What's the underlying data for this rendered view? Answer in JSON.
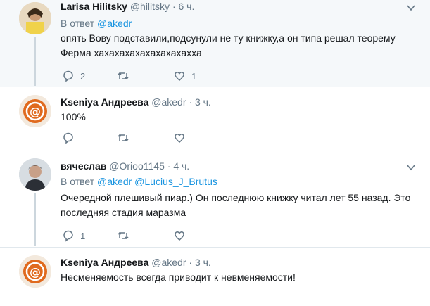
{
  "tweets": [
    {
      "name": "Larisa Hilitsky",
      "handle": "@hilitsky",
      "dot": "·",
      "time": "6 ч.",
      "reply_prefix": "В ответ",
      "reply_to": [
        "@akedr"
      ],
      "text": "опять Вову подставили,подсунули не ту книжку,а он типа решал теорему Ферма хахахахахахахахахахха",
      "replies": "2",
      "retweets": "",
      "likes": "1"
    },
    {
      "name": "Kseniya Андреева",
      "handle": "@akedr",
      "dot": "·",
      "time": "3 ч.",
      "text": "100%",
      "replies": "",
      "retweets": "",
      "likes": ""
    },
    {
      "name": "вячеслав",
      "handle": "@Orioo1145",
      "dot": "·",
      "time": "4 ч.",
      "reply_prefix": "В ответ",
      "reply_to": [
        "@akedr",
        "@Lucius_J_Brutus"
      ],
      "text": "Очередной плешивый пиар.) Он последнюю книжку читал лет 55 назад. Это последняя стадия маразма",
      "replies": "1",
      "retweets": "",
      "likes": ""
    },
    {
      "name": "Kseniya Андреева",
      "handle": "@akedr",
      "dot": "·",
      "time": "3 ч.",
      "text": "Несменяемость всегда приводит к невменяемости!"
    }
  ],
  "colors": {
    "link": "#1b95e0",
    "secondary": "#657786",
    "divider": "#e1e8ed"
  }
}
